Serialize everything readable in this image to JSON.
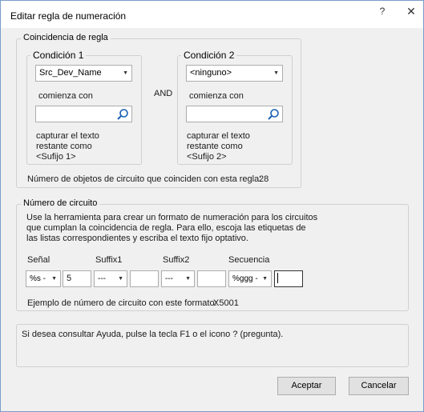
{
  "window": {
    "title": "Editar regla de numeración",
    "help_glyph": "?",
    "close_glyph": "✕"
  },
  "match_group": {
    "legend": "Coincidencia de regla",
    "condition1": {
      "legend": "Condición 1",
      "dropdown_value": "Src_Dev_Name",
      "operator_label": "comienza con",
      "search_value": "",
      "capture_text": [
        "capturar el texto",
        "restante como",
        "<Sufijo 1>"
      ]
    },
    "and_label": "AND",
    "condition2": {
      "legend": "Condición 2",
      "dropdown_value": "<ninguno>",
      "operator_label": "comienza con",
      "search_value": "",
      "capture_text": [
        "capturar el texto",
        "restante como",
        "<Sufijo 2>"
      ]
    },
    "match_count_label": "Número de objetos de circuito que coinciden con esta regla:",
    "match_count": "28"
  },
  "circuit_group": {
    "legend": "Número de circuito",
    "instructions": [
      "Use la herramienta para crear un formato de numeración para los circuitos",
      "que cumplan la coincidencia de regla. Para ello, escoja las etiquetas de",
      "las listas correspondientes y escriba el texto fijo optativo."
    ],
    "columns": {
      "signal": "Señal",
      "suffix1": "Suffix1",
      "suffix2": "Suffix2",
      "sequence": "Secuencia"
    },
    "signal_combo": "%s -",
    "signal_text": "5",
    "suffix1_combo": "---",
    "suffix1_text": "",
    "suffix2_combo": "---",
    "suffix2_text": "",
    "sequence_combo": "%ggg -",
    "sequence_text": "",
    "example_label": "Ejemplo de número de circuito con este formato:",
    "example_value": "X5001"
  },
  "help_text": "Si desea consultar Ayuda, pulse la tecla F1 o el icono ? (pregunta).",
  "buttons": {
    "accept": "Aceptar",
    "cancel": "Cancelar"
  },
  "icons": {
    "search": "magnifier-icon",
    "dropdown": "chevron-down-icon"
  }
}
